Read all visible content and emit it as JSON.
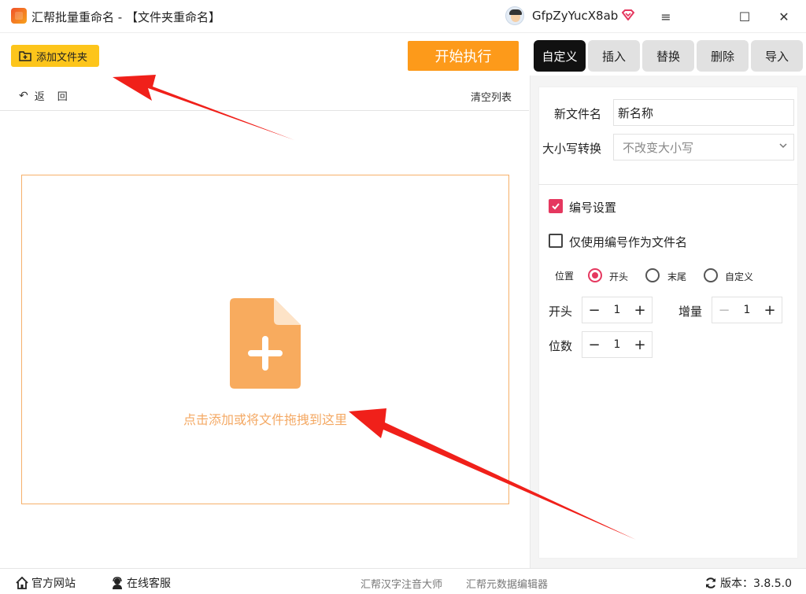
{
  "window": {
    "title": "汇帮批量重命名 - 【文件夹重命名】",
    "user_name": "GfpZyYucX8ab",
    "controls": {
      "menu": "≡",
      "maximize": "☐",
      "close": "✕"
    }
  },
  "toolbar": {
    "add_folder_label": "添加文件夹",
    "start_label": "开始执行"
  },
  "tabs": [
    {
      "label": "自定义",
      "active": true
    },
    {
      "label": "插入",
      "active": false
    },
    {
      "label": "替换",
      "active": false
    },
    {
      "label": "删除",
      "active": false
    },
    {
      "label": "导入",
      "active": false
    }
  ],
  "list": {
    "back_label_1": "返",
    "back_label_2": "回",
    "clear_label": "清空列表",
    "drop_text": "点击添加或将文件拖拽到这里"
  },
  "settings": {
    "new_name_label": "新文件名",
    "new_name_value": "新名称",
    "case_label": "大小写转换",
    "case_value": "不改变大小写",
    "numbering_label": "编号设置",
    "numbering_checked": true,
    "only_number_label": "仅使用编号作为文件名",
    "only_number_checked": false,
    "position_label": "位置",
    "position_options": [
      "开头",
      "末尾",
      "自定义"
    ],
    "position_selected": "开头",
    "start_label": "开头",
    "start_value": "1",
    "increment_label": "增量",
    "increment_value": "1",
    "digits_label": "位数",
    "digits_value": "1"
  },
  "footer": {
    "official_site": "官方网站",
    "online_service": "在线客服",
    "link_1": "汇帮汉字注音大师",
    "link_2": "汇帮元数据编辑器",
    "version_label": "版本：3.8.5.0"
  },
  "colors": {
    "accent_yellow": "#fdc51b",
    "accent_orange": "#fd9a1a",
    "checked_pink": "#e5385f",
    "drop_text": "#f4a964",
    "annotation_red": "#f0201a"
  }
}
